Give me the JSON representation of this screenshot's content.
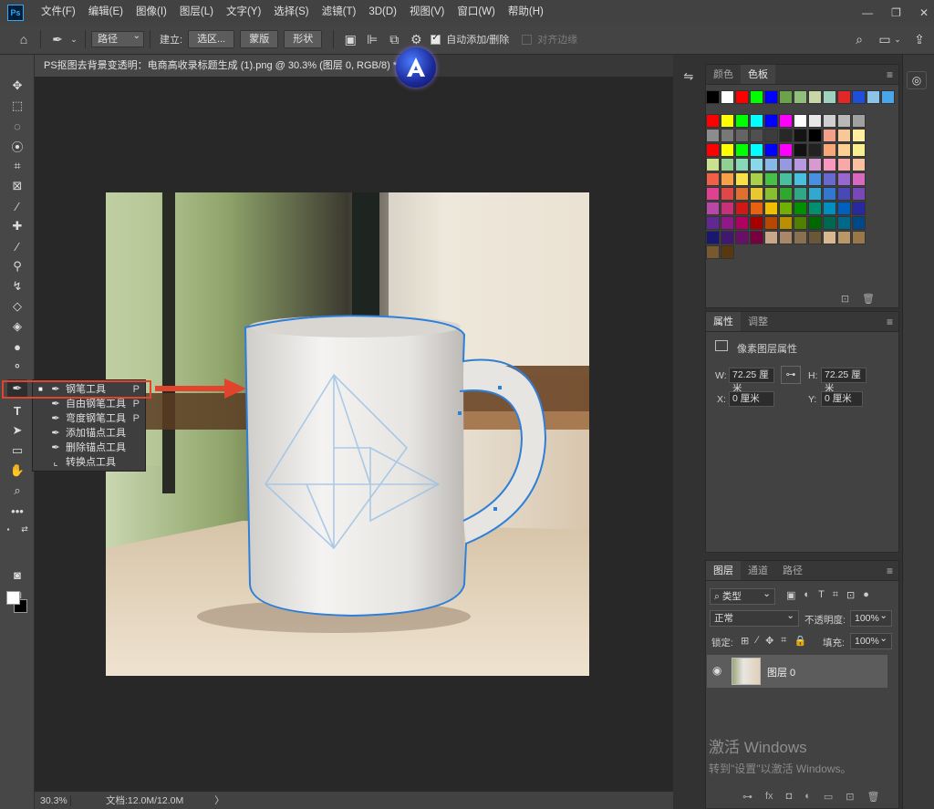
{
  "app": {
    "logo_text": "Ps",
    "menu": [
      "文件(F)",
      "编辑(E)",
      "图像(I)",
      "图层(L)",
      "文字(Y)",
      "选择(S)",
      "滤镜(T)",
      "3D(D)",
      "视图(V)",
      "窗口(W)",
      "帮助(H)"
    ],
    "window_controls": [
      "—",
      "❐",
      "✕"
    ]
  },
  "options_bar": {
    "mode_select": "路径",
    "make_label": "建立:",
    "btn_selection": "选区...",
    "btn_mask": "蒙版",
    "btn_shape": "形状",
    "auto_add_label": "自动添加/删除",
    "align_edges_label": "对齐边缘"
  },
  "document": {
    "tab_title": "PS抠图去背景变透明：电商高收录标题生成 (1).png @ 30.3% (图层 0, RGB/8) *",
    "tab_close": "×"
  },
  "status_bar": {
    "zoom": "30.3%",
    "doc_info": "文档:12.0M/12.0M",
    "arrow": "〉"
  },
  "flyout": {
    "items": [
      {
        "label": "钢笔工具",
        "shortcut": "P",
        "selected": true,
        "icon": "pen-icon"
      },
      {
        "label": "自由钢笔工具",
        "shortcut": "P",
        "selected": false,
        "icon": "freeform-pen-icon"
      },
      {
        "label": "弯度钢笔工具",
        "shortcut": "P",
        "selected": false,
        "icon": "curvature-pen-icon"
      },
      {
        "label": "添加锚点工具",
        "shortcut": "",
        "selected": false,
        "icon": "add-anchor-icon"
      },
      {
        "label": "删除锚点工具",
        "shortcut": "",
        "selected": false,
        "icon": "delete-anchor-icon"
      },
      {
        "label": "转换点工具",
        "shortcut": "",
        "selected": false,
        "icon": "convert-point-icon"
      }
    ],
    "selected_dot": "■"
  },
  "panels": {
    "color_tabs": [
      "颜色",
      "色板"
    ],
    "properties_tabs": [
      "属性",
      "调整"
    ],
    "properties": {
      "section_title": "像素图层属性",
      "w_label": "W:",
      "w_value": "72.25 厘米",
      "h_label": "H:",
      "h_value": "72.25 厘米",
      "x_label": "X:",
      "x_value": "0 厘米",
      "y_label": "Y:",
      "y_value": "0 厘米"
    },
    "layers_tabs": [
      "图层",
      "通道",
      "路径"
    ],
    "layers": {
      "filter_select": "类型",
      "blend_mode": "正常",
      "opacity_label": "不透明度:",
      "opacity_value": "100%",
      "lock_label": "锁定:",
      "fill_label": "填充:",
      "fill_value": "100%",
      "layer_name": "图层 0"
    },
    "panel_menu": "≡"
  },
  "watermark": {
    "title": "激活 Windows",
    "subtitle": "转到\"设置\"以激活 Windows。"
  },
  "swatch_colors": {
    "row0": [
      "#000000",
      "#ffffff",
      "#ff0000",
      "#00ff00",
      "#0000ff",
      "#6da24c",
      "#8fbf7a",
      "#c8d6a8",
      "#9fd0c0",
      "#e02828",
      "#1f4fd8",
      "#8cc3e8",
      "#49a6e8"
    ],
    "rows": [
      [
        "#ff0000",
        "#ffff00",
        "#00ff00",
        "#00ffff",
        "#0000ff",
        "#ff00ff",
        "#ffffff",
        "#e8e8e8",
        "#d0d0d0",
        "#b8b8b8",
        "#a0a0a0"
      ],
      [
        "#8c8c8c",
        "#787878",
        "#646464",
        "#505050",
        "#3c3c3c",
        "#282828",
        "#141414",
        "#000000",
        "#f4a088",
        "#f8c898",
        "#fff0a0"
      ],
      [
        "#ff0000",
        "#ffff00",
        "#00ff00",
        "#00ffff",
        "#0000ff",
        "#ff00ff",
        "#111111",
        "#222222",
        "#f8a878",
        "#fcd090",
        "#f8f090"
      ],
      [
        "#c8e090",
        "#90d090",
        "#88d8b8",
        "#88d8e8",
        "#88b8e8",
        "#9898e0",
        "#b898e0",
        "#d898d0",
        "#f898c0",
        "#f8a8a8",
        "#f8c0a0"
      ],
      [
        "#f06048",
        "#f8a048",
        "#f8e048",
        "#a8d048",
        "#48c048",
        "#48c0a0",
        "#48c0e0",
        "#4890e0",
        "#6868d0",
        "#9868d0",
        "#d868c0"
      ],
      [
        "#e04090",
        "#e04848",
        "#e07030",
        "#e8c830",
        "#88c030",
        "#30a830",
        "#30a888",
        "#30a8d0",
        "#3078d0",
        "#4848b8",
        "#7848b8"
      ],
      [
        "#b848a8",
        "#c83078",
        "#d01818",
        "#e86010",
        "#f0c000",
        "#70b000",
        "#009000",
        "#009070",
        "#0090c0",
        "#0060c0",
        "#2828a0"
      ],
      [
        "#602890",
        "#901888",
        "#b00060",
        "#a80000",
        "#b84800",
        "#b89000",
        "#508000",
        "#006800",
        "#006850",
        "#006888",
        "#004888"
      ],
      [
        "#181870",
        "#401870",
        "#681068",
        "#780040",
        "#c8a888",
        "#a88868",
        "#887050",
        "#685838",
        "#d8b890",
        "#b89868",
        "#987848"
      ],
      [
        "#785830",
        "#583810"
      ]
    ]
  }
}
